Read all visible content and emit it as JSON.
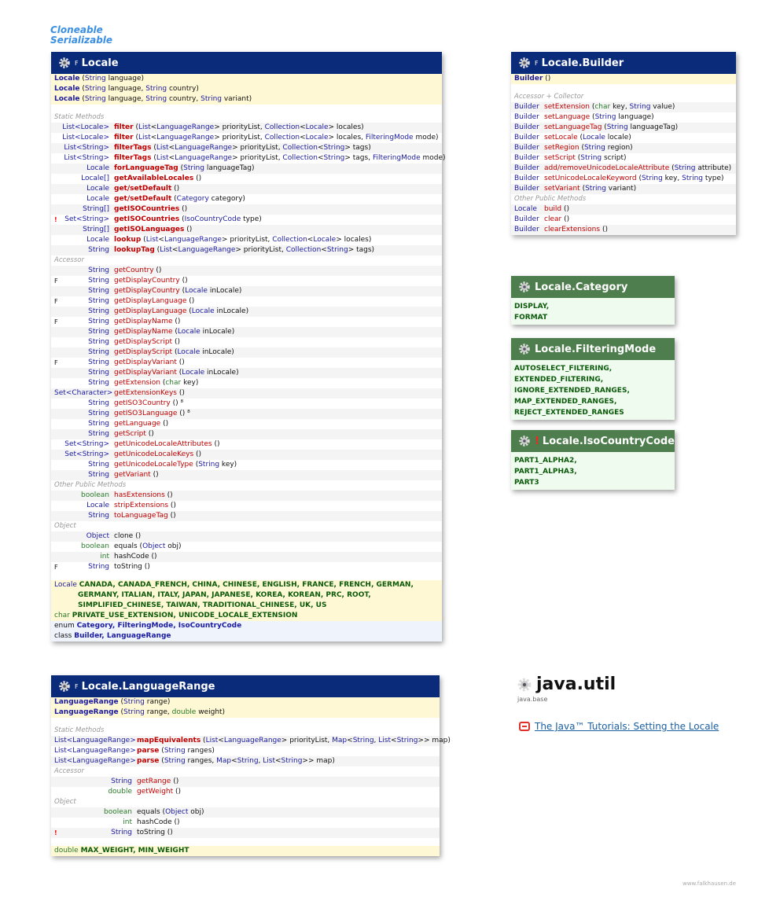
{
  "interfaces": [
    "Cloneable",
    "Serializable"
  ],
  "locale": {
    "title": "Locale",
    "modifier": "F",
    "constructors": [
      {
        "name": "Locale",
        "params": [
          [
            "String",
            " language"
          ]
        ]
      },
      {
        "name": "Locale",
        "params": [
          [
            "String",
            " language, "
          ],
          [
            "String",
            " country"
          ]
        ]
      },
      {
        "name": "Locale",
        "params": [
          [
            "String",
            " language, "
          ],
          [
            "String",
            " country, "
          ],
          [
            "String",
            " variant"
          ]
        ]
      }
    ],
    "sections": [
      {
        "label": "Static Methods",
        "rows": [
          {
            "mark": "",
            "ret": "List<Locale>",
            "name": "filter",
            "bold": true,
            "params": "(List<LanguageRange> priorityList, Collection<Locale> locales)"
          },
          {
            "mark": "",
            "ret": "List<Locale>",
            "name": "filter",
            "bold": true,
            "params": "(List<LanguageRange> priorityList, Collection<Locale> locales, FilteringMode mode)"
          },
          {
            "mark": "",
            "ret": "List<String>",
            "name": "filterTags",
            "bold": true,
            "params": "(List<LanguageRange> priorityList, Collection<String> tags)"
          },
          {
            "mark": "",
            "ret": "List<String>",
            "name": "filterTags",
            "bold": true,
            "params": "(List<LanguageRange> priorityList, Collection<String> tags, FilteringMode mode)"
          },
          {
            "mark": "",
            "ret": "Locale",
            "name": "forLanguageTag",
            "bold": true,
            "params": "(String languageTag)"
          },
          {
            "mark": "",
            "ret": "Locale[]",
            "name": "getAvailableLocales",
            "bold": true,
            "params": "()"
          },
          {
            "mark": "",
            "ret": "Locale",
            "name": "get/setDefault",
            "bold": true,
            "params": "()"
          },
          {
            "mark": "",
            "ret": "Locale",
            "name": "get/setDefault",
            "bold": true,
            "params": "(Category category)"
          },
          {
            "mark": "",
            "ret": "String[]",
            "name": "getISOCountries",
            "bold": true,
            "params": "()"
          },
          {
            "mark": "!",
            "ret": "Set<String>",
            "name": "getISOCountries",
            "bold": true,
            "params": "(IsoCountryCode type)"
          },
          {
            "mark": "",
            "ret": "String[]",
            "name": "getISOLanguages",
            "bold": true,
            "params": "()"
          },
          {
            "mark": "",
            "ret": "Locale",
            "name": "lookup",
            "bold": true,
            "params": "(List<LanguageRange> priorityList, Collection<Locale> locales)"
          },
          {
            "mark": "",
            "ret": "String",
            "name": "lookupTag",
            "bold": true,
            "params": "(List<LanguageRange> priorityList, Collection<String> tags)"
          }
        ]
      },
      {
        "label": "Accessor",
        "rows": [
          {
            "mark": "",
            "ret": "String",
            "name": "getCountry",
            "bold": false,
            "params": "()"
          },
          {
            "mark": "F",
            "ret": "String",
            "name": "getDisplayCountry",
            "bold": false,
            "params": "()"
          },
          {
            "mark": "",
            "ret": "String",
            "name": "getDisplayCountry",
            "bold": false,
            "params": "(Locale inLocale)"
          },
          {
            "mark": "F",
            "ret": "String",
            "name": "getDisplayLanguage",
            "bold": false,
            "params": "()"
          },
          {
            "mark": "",
            "ret": "String",
            "name": "getDisplayLanguage",
            "bold": false,
            "params": "(Locale inLocale)"
          },
          {
            "mark": "F",
            "ret": "String",
            "name": "getDisplayName",
            "bold": false,
            "params": "()"
          },
          {
            "mark": "",
            "ret": "String",
            "name": "getDisplayName",
            "bold": false,
            "params": "(Locale inLocale)"
          },
          {
            "mark": "",
            "ret": "String",
            "name": "getDisplayScript",
            "bold": false,
            "params": "()"
          },
          {
            "mark": "",
            "ret": "String",
            "name": "getDisplayScript",
            "bold": false,
            "params": "(Locale inLocale)"
          },
          {
            "mark": "F",
            "ret": "String",
            "name": "getDisplayVariant",
            "bold": false,
            "params": "()"
          },
          {
            "mark": "",
            "ret": "String",
            "name": "getDisplayVariant",
            "bold": false,
            "params": "(Locale inLocale)"
          },
          {
            "mark": "",
            "ret": "String",
            "name": "getExtension",
            "bold": false,
            "params": "(char key)"
          },
          {
            "mark": "",
            "ret": "Set<Character>",
            "name": "getExtensionKeys",
            "bold": false,
            "params": "()"
          },
          {
            "mark": "",
            "ret": "String",
            "name": "getISO3Country",
            "bold": false,
            "params": "() ⁸"
          },
          {
            "mark": "",
            "ret": "String",
            "name": "getISO3Language",
            "bold": false,
            "params": "() ⁸"
          },
          {
            "mark": "",
            "ret": "String",
            "name": "getLanguage",
            "bold": false,
            "params": "()"
          },
          {
            "mark": "",
            "ret": "String",
            "name": "getScript",
            "bold": false,
            "params": "()"
          },
          {
            "mark": "",
            "ret": "Set<String>",
            "name": "getUnicodeLocaleAttributes",
            "bold": false,
            "params": "()"
          },
          {
            "mark": "",
            "ret": "Set<String>",
            "name": "getUnicodeLocaleKeys",
            "bold": false,
            "params": "()"
          },
          {
            "mark": "",
            "ret": "String",
            "name": "getUnicodeLocaleType",
            "bold": false,
            "params": "(String key)"
          },
          {
            "mark": "",
            "ret": "String",
            "name": "getVariant",
            "bold": false,
            "params": "()"
          }
        ]
      },
      {
        "label": "Other Public Methods",
        "rows": [
          {
            "mark": "",
            "ret": "boolean",
            "name": "hasExtensions",
            "bold": false,
            "params": "()"
          },
          {
            "mark": "",
            "ret": "Locale",
            "name": "stripExtensions",
            "bold": false,
            "params": "()"
          },
          {
            "mark": "",
            "ret": "String",
            "name": "toLanguageTag",
            "bold": false,
            "params": "()"
          }
        ]
      },
      {
        "label": "Object",
        "rows": [
          {
            "mark": "",
            "ret": "Object",
            "name": "clone",
            "bold": false,
            "plain": true,
            "params": "()"
          },
          {
            "mark": "",
            "ret": "boolean",
            "name": "equals",
            "bold": false,
            "plain": true,
            "params": "(Object obj)"
          },
          {
            "mark": "",
            "ret": "int",
            "name": "hashCode",
            "bold": false,
            "plain": true,
            "params": "()"
          },
          {
            "mark": "F",
            "ret": "String",
            "name": "toString",
            "bold": false,
            "plain": true,
            "params": "()"
          }
        ]
      }
    ],
    "fields_locale_type": "Locale",
    "fields_locale": [
      "CANADA, CANADA_FRENCH, CHINA, CHINESE, ENGLISH, FRANCE, FRENCH, GERMAN,",
      "GERMANY, ITALIAN, ITALY, JAPAN, JAPANESE, KOREA, KOREAN, PRC, ROOT,",
      "SIMPLIFIED_CHINESE, TAIWAN, TRADITIONAL_CHINESE, UK, US"
    ],
    "fields_char_type": "char",
    "fields_char": "PRIVATE_USE_EXTENSION, UNICODE_LOCALE_EXTENSION",
    "enum_label": "enum",
    "enums": "Category, FilteringMode, IsoCountryCode",
    "class_label": "class",
    "classes": "Builder, LanguageRange"
  },
  "builder": {
    "title": "Locale.Builder",
    "modifier": "F",
    "constructor": "Builder",
    "constructor_params": "()",
    "sections": [
      {
        "label": "Accessor + Collector",
        "rows": [
          {
            "ret": "Builder",
            "name": "setExtension",
            "params": "(char key, String value)"
          },
          {
            "ret": "Builder",
            "name": "setLanguage",
            "params": "(String language)"
          },
          {
            "ret": "Builder",
            "name": "setLanguageTag",
            "params": "(String languageTag)"
          },
          {
            "ret": "Builder",
            "name": "setLocale",
            "params": "(Locale locale)"
          },
          {
            "ret": "Builder",
            "name": "setRegion",
            "params": "(String region)"
          },
          {
            "ret": "Builder",
            "name": "setScript",
            "params": "(String script)"
          },
          {
            "ret": "Builder",
            "name": "add/removeUnicodeLocaleAttribute",
            "params": "(String attribute)"
          },
          {
            "ret": "Builder",
            "name": "setUnicodeLocaleKeyword",
            "params": "(String key, String type)"
          },
          {
            "ret": "Builder",
            "name": "setVariant",
            "params": "(String variant)"
          }
        ]
      },
      {
        "label": "Other Public Methods",
        "rows": [
          {
            "ret": "Locale",
            "name": "build",
            "params": "()"
          },
          {
            "ret": "Builder",
            "name": "clear",
            "params": "()"
          },
          {
            "ret": "Builder",
            "name": "clearExtensions",
            "params": "()"
          }
        ]
      }
    ]
  },
  "category": {
    "title": "Locale.Category",
    "values": [
      "DISPLAY,",
      "FORMAT"
    ]
  },
  "filtering": {
    "title": "Locale.FilteringMode",
    "values": [
      "AUTOSELECT_FILTERING,",
      "EXTENDED_FILTERING,",
      "IGNORE_EXTENDED_RANGES,",
      "MAP_EXTENDED_RANGES,",
      "REJECT_EXTENDED_RANGES"
    ]
  },
  "isocode": {
    "title": "Locale.IsoCountryCode",
    "mark": "!",
    "values": [
      "PART1_ALPHA2,",
      "PART1_ALPHA3,",
      "PART3"
    ]
  },
  "langrange": {
    "title": "Locale.LanguageRange",
    "modifier": "F",
    "constructors": [
      {
        "name": "LanguageRange",
        "params": "(String range)"
      },
      {
        "name": "LanguageRange",
        "params": "(String range, double weight)"
      }
    ],
    "sections": [
      {
        "label": "Static Methods",
        "rows": [
          {
            "mark": "",
            "ret": "List<LanguageRange>",
            "name": "mapEquivalents",
            "bold": true,
            "params": "(List<LanguageRange> priorityList, Map<String, List<String>> map)"
          },
          {
            "mark": "",
            "ret": "List<LanguageRange>",
            "name": "parse",
            "bold": true,
            "params": "(String ranges)"
          },
          {
            "mark": "",
            "ret": "List<LanguageRange>",
            "name": "parse",
            "bold": true,
            "params": "(String ranges, Map<String, List<String>> map)"
          }
        ]
      },
      {
        "label": "Accessor",
        "rows": [
          {
            "mark": "",
            "ret": "String",
            "name": "getRange",
            "bold": false,
            "params": "()"
          },
          {
            "mark": "",
            "ret": "double",
            "name": "getWeight",
            "bold": false,
            "params": "()"
          }
        ]
      },
      {
        "label": "Object",
        "rows": [
          {
            "mark": "",
            "ret": "boolean",
            "name": "equals",
            "bold": false,
            "plain": true,
            "params": "(Object obj)"
          },
          {
            "mark": "",
            "ret": "int",
            "name": "hashCode",
            "bold": false,
            "plain": true,
            "params": "()"
          },
          {
            "mark": "!",
            "ret": "String",
            "name": "toString",
            "bold": false,
            "plain": true,
            "params": "()"
          }
        ]
      }
    ],
    "fields_type": "double",
    "fields": "MAX_WEIGHT, MIN_WEIGHT"
  },
  "package": {
    "name": "java.util",
    "module": "java.base"
  },
  "tutorial_link": "The Java™ Tutorials: Setting the Locale",
  "footer": "www.falkhausen.de"
}
